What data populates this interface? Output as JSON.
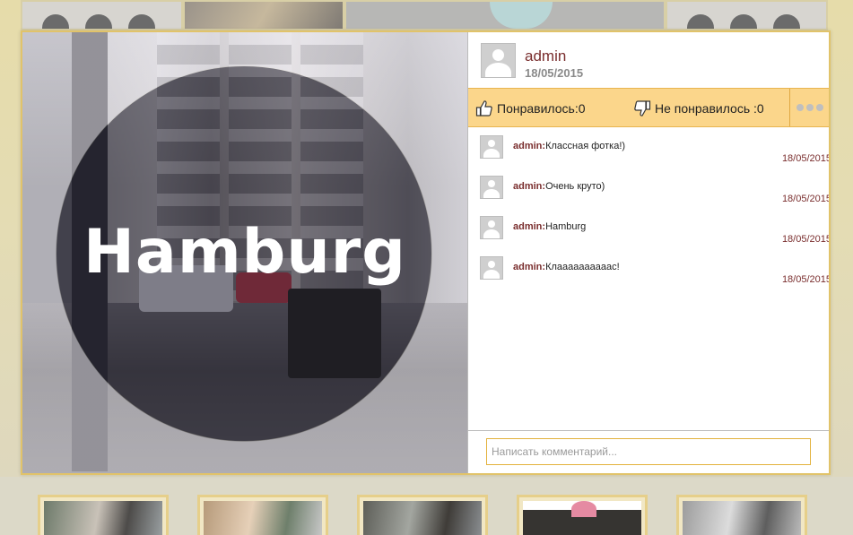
{
  "post": {
    "author": "admin",
    "date": "18/05/2015",
    "photo_caption": "Hamburg"
  },
  "reactions": {
    "like_label": "Понравилось:0",
    "dislike_label": "Не понравилось :0",
    "like_icon": "thumbs-up-icon",
    "dislike_icon": "thumbs-down-icon",
    "more_icon": "more-dots-icon"
  },
  "comments": [
    {
      "author": "admin:",
      "text": "Классная фотка!)",
      "date": "18/05/2015"
    },
    {
      "author": "admin:",
      "text": "Очень круто)",
      "date": "18/05/2015"
    },
    {
      "author": "admin:",
      "text": "Hamburg",
      "date": "18/05/2015"
    },
    {
      "author": "admin:",
      "text": "Клаааааааааас!",
      "date": "18/05/2015"
    }
  ],
  "compose": {
    "placeholder": "Написать комментарий...",
    "value": ""
  },
  "colors": {
    "accent": "#fbd68b",
    "border": "#e1c36a",
    "author_text": "#7a2e2e"
  }
}
